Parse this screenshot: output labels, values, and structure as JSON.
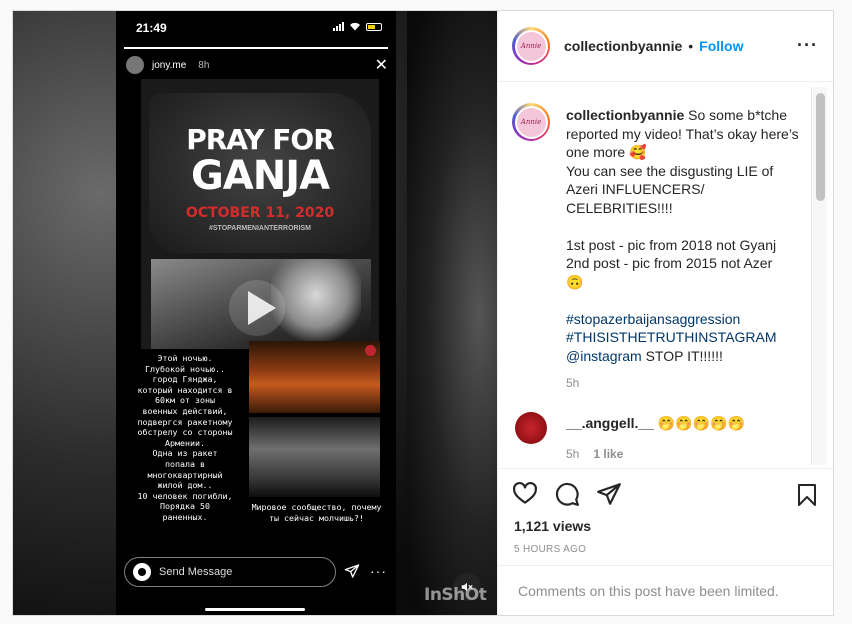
{
  "story": {
    "clock": "21:49",
    "username": "jony.me",
    "time": "8h",
    "poster_line1": "PRAY FOR",
    "poster_line2": "GANJA",
    "poster_date": "OCTOBER 11, 2020",
    "poster_hashtag": "#STOPARMENIANTERRORISM",
    "ru_text_left": "Этой ночью.\nГлубокой ночью..\nгород Гянджа,\nкоторый находится в\n60км от зоны\nвоенных действий,\nподвергся ракетному\nобстрелу со стороны\nАрмении.\nОдна из ракет\nпопала в\nмногоквартирный\nжилой дом..\n10 человек погибли,\nПорядка 50\nраненных.",
    "ru_text_right": "Мировое сообщество, почему\nты сейчас молчишь?!",
    "send_placeholder": "Send Message",
    "watermark": "InShOt"
  },
  "post": {
    "username": "collectionbyannie",
    "follow_label": "Follow",
    "avatar_text": "Annie",
    "caption": {
      "text_main": " So some b*tche reported my video! That’s okay here’s one more 🥰\nYou can see the disgusting LIE of Azeri INFLUENCERS/ CELEBRITIES!!!!\n\n1st post - pic from 2018 not Gyanj\n2nd post - pic from 2015 not Azer\n🙃\n\n",
      "hashtag1": "#stopazerbaijansaggression",
      "hashtag2": "#THISISTHETRUTHINSTAGRAM",
      "mention": "@instagram",
      "tail": " STOP IT!!!!!!",
      "time": "5h"
    },
    "comment": {
      "username": "__.anggell.__",
      "text": "🤭🤭🤭🤭🤭",
      "time": "5h",
      "likes": "1 like"
    },
    "views": "1,121 views",
    "posted_ago": "5 HOURS AGO",
    "comments_limited": "Comments on this post have been limited."
  }
}
